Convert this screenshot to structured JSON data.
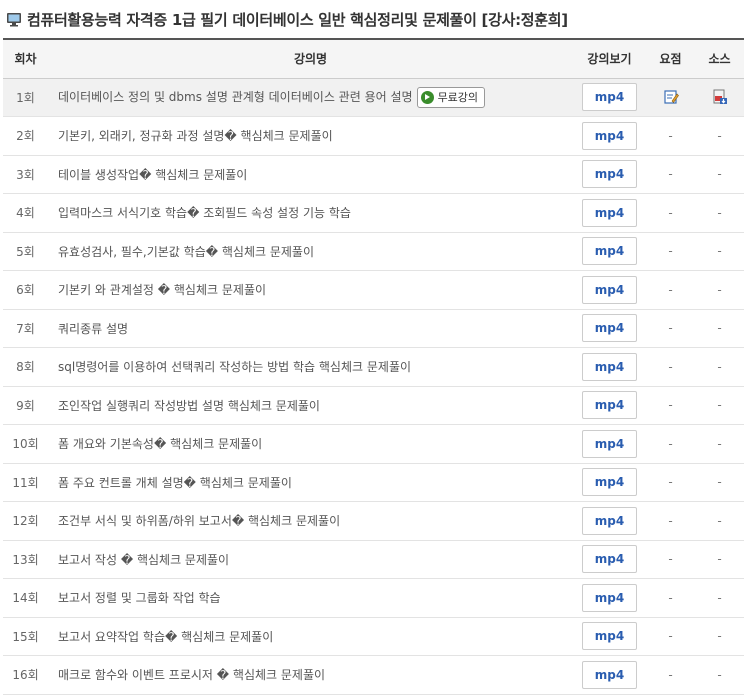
{
  "title": "컴퓨터활용능력 자격증 1급 필기 데이터베이스 일반 핵심정리및 문제풀이 [강사:정훈희]",
  "columns": {
    "no": "회차",
    "name": "강의명",
    "view": "강의보기",
    "summary": "요점",
    "source": "소스"
  },
  "free_label": "무료강의",
  "rows": [
    {
      "no": "1회",
      "name": "데이터베이스 정의 및 dbms 설명 관계형 데이터베이스 관련 용어 설명",
      "view": "mp4",
      "summary": "",
      "source": ""
    },
    {
      "no": "2회",
      "name": "기본키, 외래키, 정규화 과정 설명� 핵심체크 문제풀이",
      "view": "mp4",
      "summary": "-",
      "source": "-"
    },
    {
      "no": "3회",
      "name": "테이블 생성작업� 핵심체크 문제풀이",
      "view": "mp4",
      "summary": "-",
      "source": "-"
    },
    {
      "no": "4회",
      "name": "입력마스크 서식기호 학습� 조회필드 속성 설정 기능 학습",
      "view": "mp4",
      "summary": "-",
      "source": "-"
    },
    {
      "no": "5회",
      "name": "유효성검사, 필수,기본값 학습� 핵심체크 문제풀이",
      "view": "mp4",
      "summary": "-",
      "source": "-"
    },
    {
      "no": "6회",
      "name": "기본키 와 관계설정 � 핵심체크 문제풀이",
      "view": "mp4",
      "summary": "-",
      "source": "-"
    },
    {
      "no": "7회",
      "name": "쿼리종류 설명",
      "view": "mp4",
      "summary": "-",
      "source": "-"
    },
    {
      "no": "8회",
      "name": "sql명령어를 이용하여 선택쿼리 작성하는 방법 학습 핵심체크 문제풀이",
      "view": "mp4",
      "summary": "-",
      "source": "-"
    },
    {
      "no": "9회",
      "name": "조인작업 실행쿼리 작성방법 설명 핵심체크 문제풀이",
      "view": "mp4",
      "summary": "-",
      "source": "-"
    },
    {
      "no": "10회",
      "name": "폼 개요와 기본속성� 핵심체크 문제풀이",
      "view": "mp4",
      "summary": "-",
      "source": "-"
    },
    {
      "no": "11회",
      "name": "폼 주요 컨트롤 개체 설명� 핵심체크 문제풀이",
      "view": "mp4",
      "summary": "-",
      "source": "-"
    },
    {
      "no": "12회",
      "name": "조건부 서식 및 하위폼/하위 보고서� 핵심체크 문제풀이",
      "view": "mp4",
      "summary": "-",
      "source": "-"
    },
    {
      "no": "13회",
      "name": "보고서 작성 � 핵심체크 문제풀이",
      "view": "mp4",
      "summary": "-",
      "source": "-"
    },
    {
      "no": "14회",
      "name": "보고서 정렬 및 그룹화 작업 학습",
      "view": "mp4",
      "summary": "-",
      "source": "-"
    },
    {
      "no": "15회",
      "name": "보고서 요약작업 학습� 핵심체크 문제풀이",
      "view": "mp4",
      "summary": "-",
      "source": "-"
    },
    {
      "no": "16회",
      "name": "매크로 함수와 이벤트 프로시저 � 핵심체크 문제풀이",
      "view": "mp4",
      "summary": "-",
      "source": "-"
    }
  ]
}
